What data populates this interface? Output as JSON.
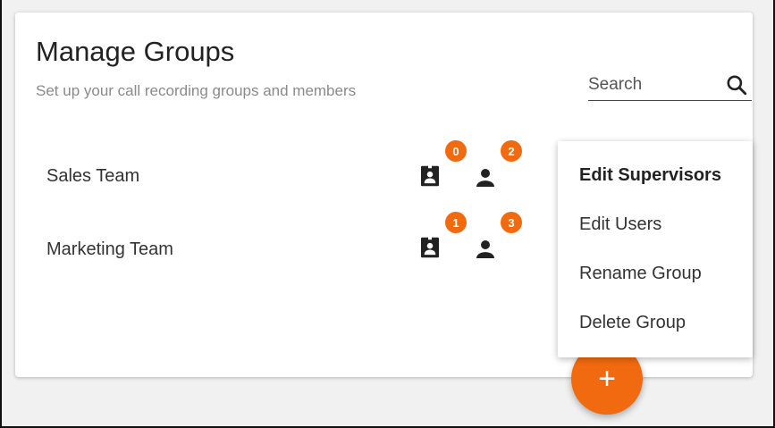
{
  "header": {
    "title": "Manage Groups",
    "subtitle": "Set up your call recording groups and members"
  },
  "search": {
    "placeholder": "Search",
    "value": "",
    "icon": "search-icon"
  },
  "groups": [
    {
      "name": "Sales Team",
      "supervisors_count": "0",
      "users_count": "2"
    },
    {
      "name": "Marketing Team",
      "supervisors_count": "1",
      "users_count": "3"
    }
  ],
  "icons": {
    "supervisors": "supervisor-badge-icon",
    "users": "user-icon"
  },
  "context_menu": {
    "items": [
      "Edit Supervisors",
      "Edit Users",
      "Rename Group",
      "Delete Group"
    ],
    "highlighted": "Edit Supervisors"
  },
  "fab": {
    "label": "+",
    "icon": "add-icon"
  },
  "colors": {
    "accent": "#f26a0f",
    "text": "#333333",
    "muted": "#8a8a8a"
  }
}
